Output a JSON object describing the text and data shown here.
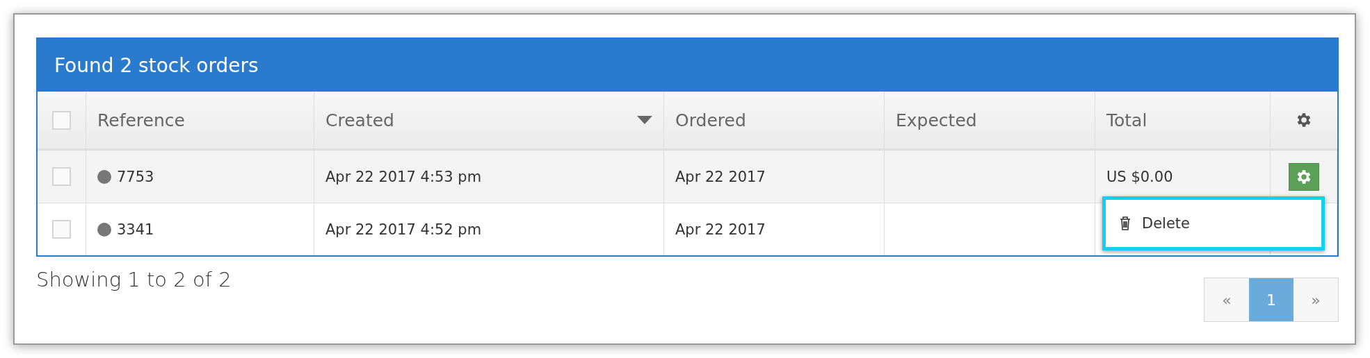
{
  "panel": {
    "title": "Found 2 stock orders"
  },
  "table": {
    "select_all": {
      "checked": false
    },
    "columns": [
      {
        "label": "Reference",
        "sorted": false
      },
      {
        "label": "Created",
        "sorted": true
      },
      {
        "label": "Ordered",
        "sorted": false
      },
      {
        "label": "Expected",
        "sorted": false
      },
      {
        "label": "Total",
        "sorted": false
      }
    ],
    "rows": [
      {
        "checked": false,
        "menu_open": true,
        "reference": "7753",
        "created": "Apr 22 2017 4:53 pm",
        "ordered": "Apr 22 2017",
        "expected": "",
        "total": "US $0.00"
      },
      {
        "checked": false,
        "menu_open": false,
        "reference": "3341",
        "created": "Apr 22 2017 4:52 pm",
        "ordered": "Apr 22 2017",
        "expected": "",
        "total": ""
      }
    ]
  },
  "row_menu": {
    "items": [
      "Delete"
    ]
  },
  "footer": {
    "summary": "Showing 1 to 2 of 2"
  },
  "pagination": [
    {
      "label": "«",
      "selected": false
    },
    {
      "label": "1",
      "selected": true
    },
    {
      "label": "»",
      "selected": false
    }
  ]
}
